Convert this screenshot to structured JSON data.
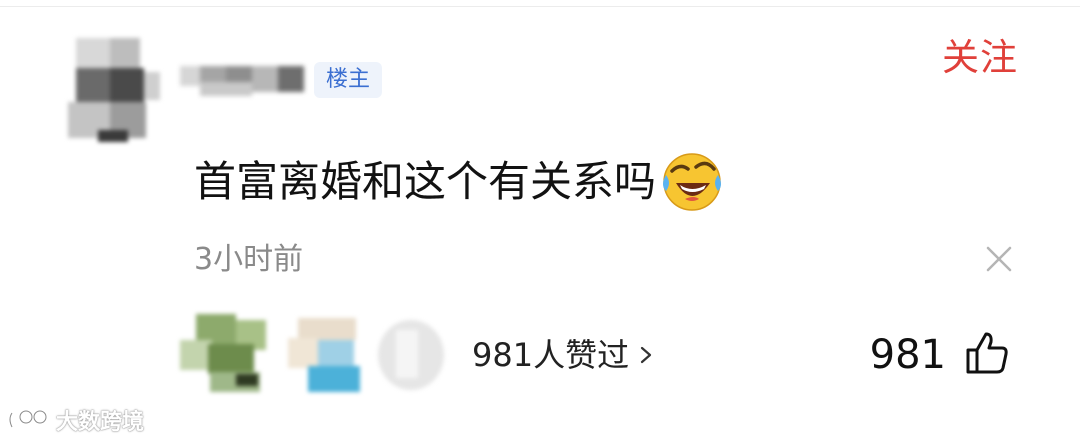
{
  "post": {
    "owner_badge": "楼主",
    "follow_label": "关注",
    "comment_text": "首富离婚和这个有关系吗",
    "comment_emoji": "crying-laughing-emoji",
    "timestamp": "3小时前",
    "likers_text": "981人赞过",
    "like_count": "981"
  },
  "icons": {
    "dismiss": "close-icon",
    "like": "thumbs-up-icon",
    "chevron": "chevron-right-icon"
  },
  "watermark": {
    "text": "大数跨境"
  },
  "colors": {
    "follow": "#e0403a",
    "badge_text": "#3b6fd1",
    "badge_bg": "#eef3fb",
    "muted": "#8a8a8a"
  }
}
